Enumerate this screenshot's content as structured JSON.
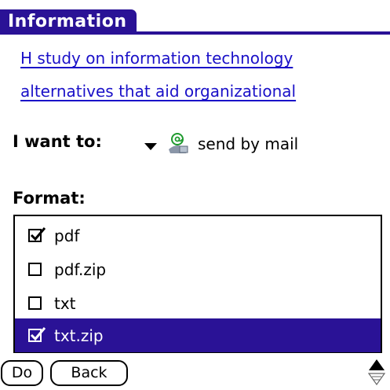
{
  "title": "Information",
  "document": {
    "link_line1": "H study on information technology",
    "link_line2": "alternatives that aid organizational"
  },
  "action": {
    "label": "I want to:",
    "selected": "send by mail",
    "icon": "mail-icon"
  },
  "format": {
    "label": "Format:",
    "items": [
      {
        "label": "pdf",
        "checked": true,
        "selected": false
      },
      {
        "label": "pdf.zip",
        "checked": false,
        "selected": false
      },
      {
        "label": "txt",
        "checked": false,
        "selected": false
      },
      {
        "label": "txt.zip",
        "checked": true,
        "selected": true
      }
    ]
  },
  "buttons": {
    "do": "Do",
    "back": "Back"
  },
  "colors": {
    "accent": "#2a1296",
    "link": "#1a10c8"
  }
}
